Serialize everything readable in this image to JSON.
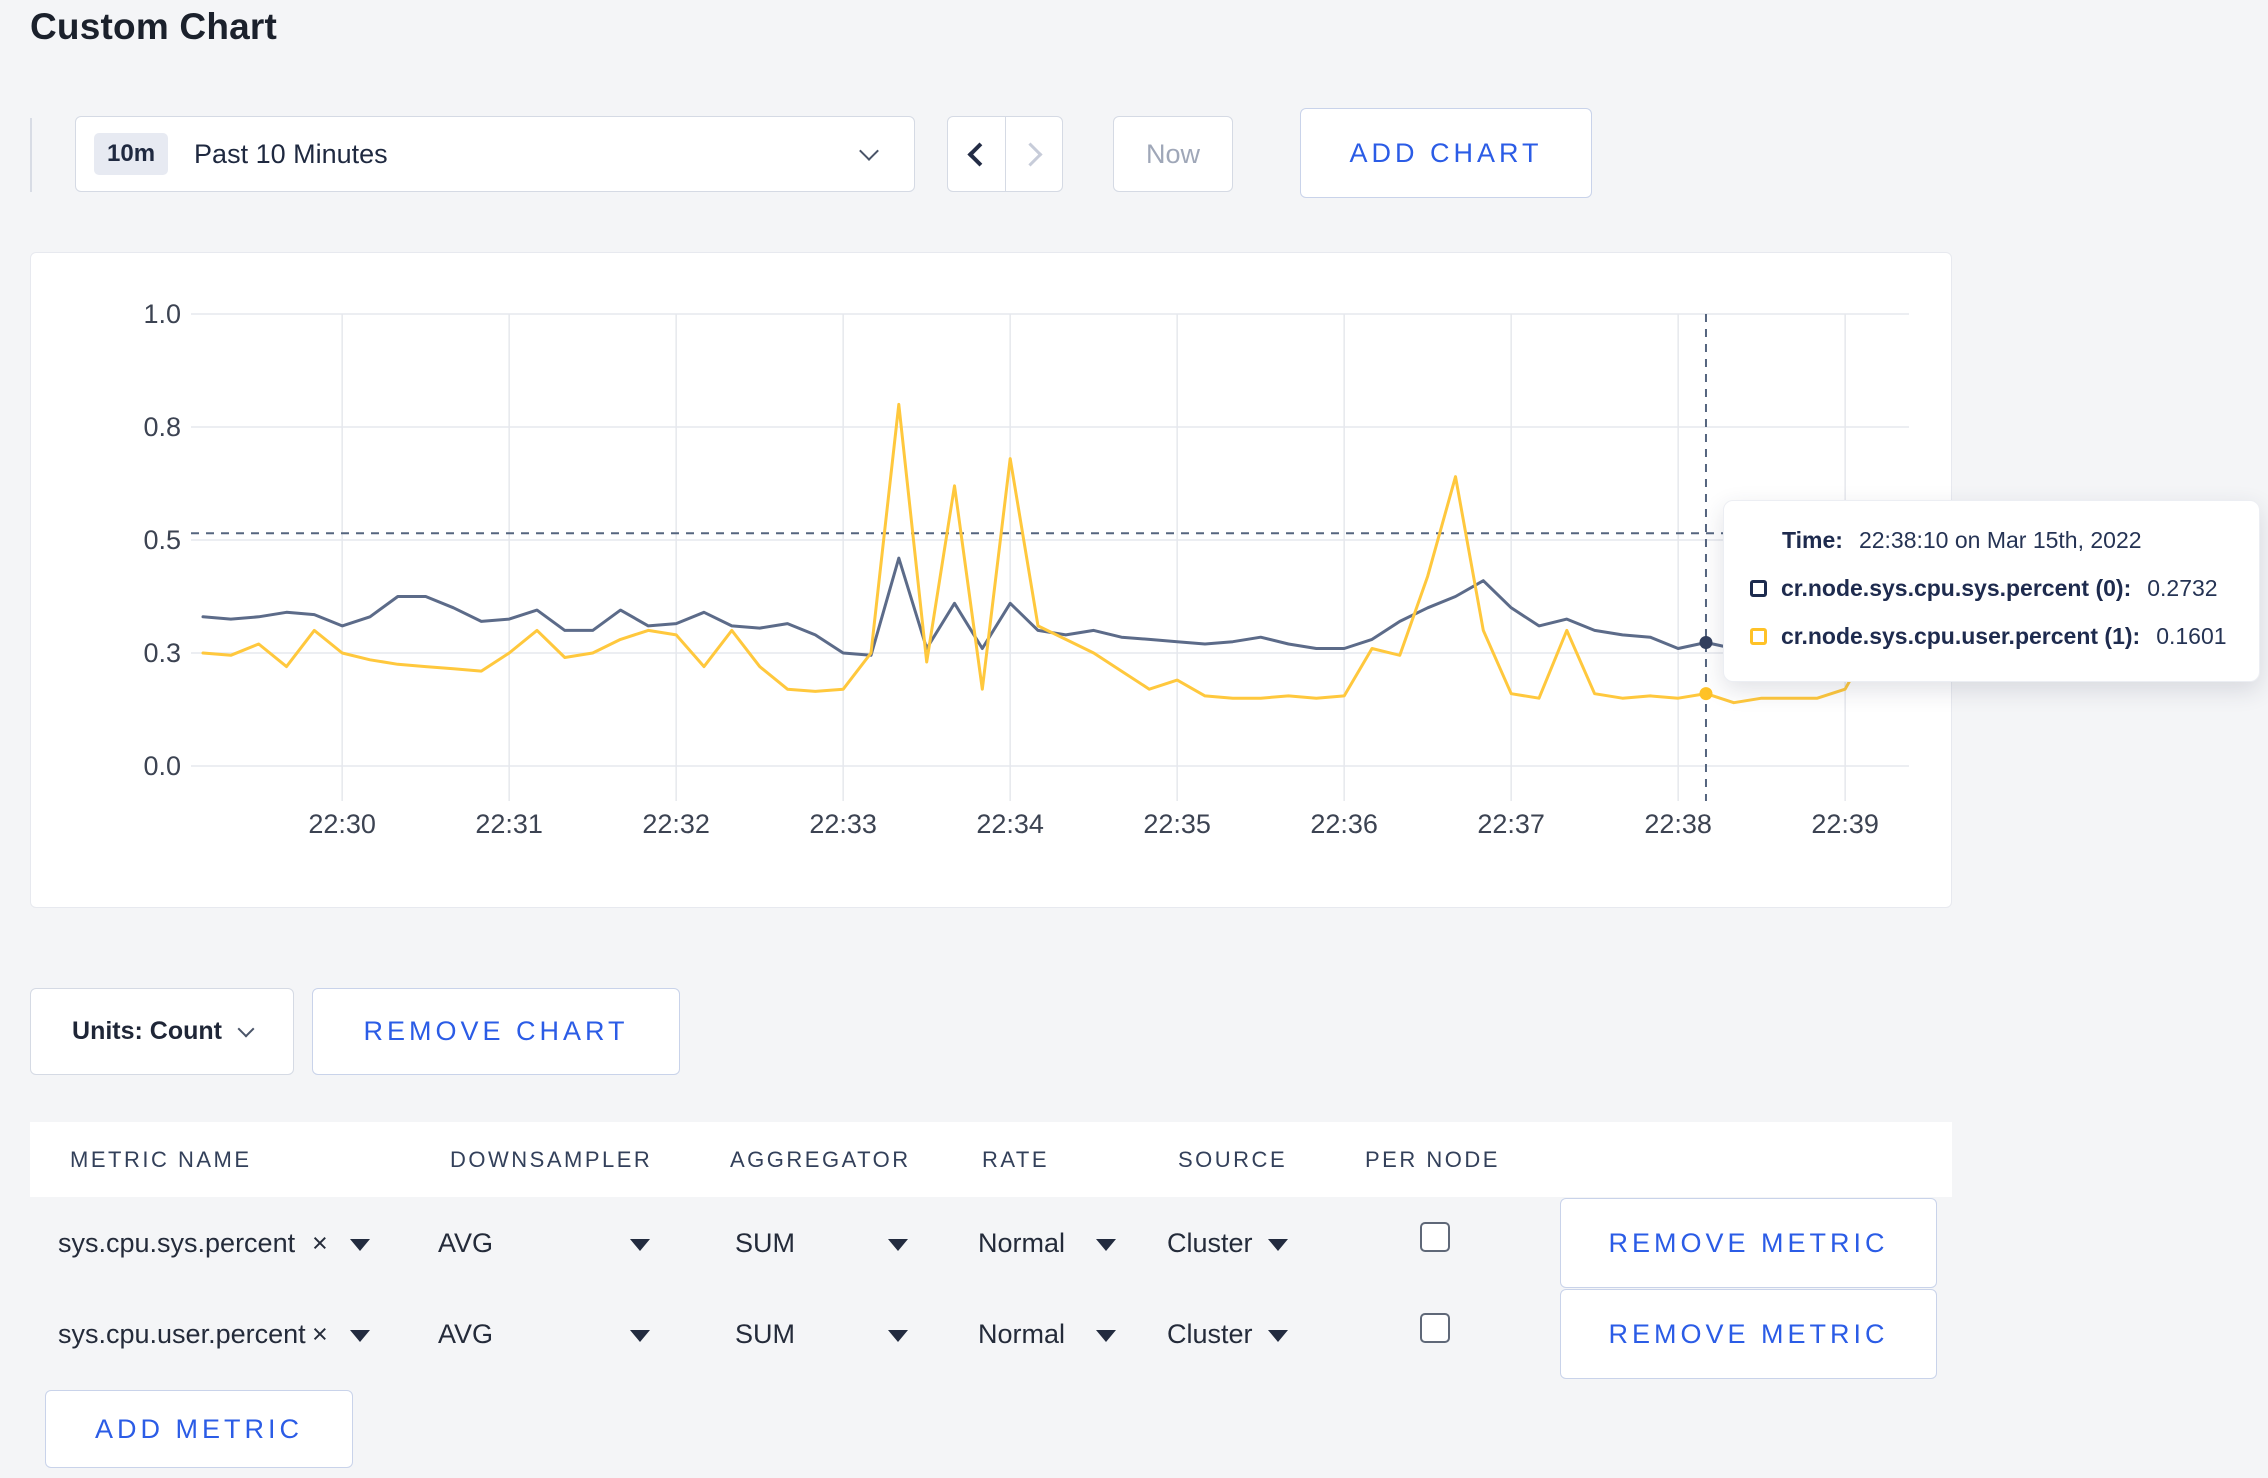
{
  "page": {
    "title": "Custom Chart"
  },
  "toolbar": {
    "time_badge": "10m",
    "time_range": "Past 10 Minutes",
    "now_label": "Now",
    "add_chart_label": "ADD CHART"
  },
  "chart": {
    "units_label": "Units: Count",
    "remove_chart_label": "REMOVE CHART"
  },
  "tooltip": {
    "time_label": "Time:",
    "time_value": "22:38:10 on Mar 15th, 2022",
    "series": [
      {
        "name": "cr.node.sys.cpu.sys.percent (0):",
        "value": "0.2732",
        "color": "#1C2B4E"
      },
      {
        "name": "cr.node.sys.cpu.user.percent (1):",
        "value": "0.1601",
        "color": "#FFC227"
      }
    ]
  },
  "chart_data": {
    "type": "line",
    "title": "",
    "xlabel": "",
    "ylabel": "",
    "ylim": [
      0,
      1
    ],
    "grid": true,
    "x_start_time": "22:29:10",
    "x_step_seconds": 10,
    "x_ticks": [
      "22:30",
      "22:31",
      "22:32",
      "22:33",
      "22:34",
      "22:35",
      "22:36",
      "22:37",
      "22:38",
      "22:39"
    ],
    "y_ticks": [
      {
        "label": "0.0",
        "value": 0
      },
      {
        "label": "0.3",
        "value": 0.25
      },
      {
        "label": "0.5",
        "value": 0.5
      },
      {
        "label": "0.8",
        "value": 0.75
      },
      {
        "label": "1.0",
        "value": 1.0
      }
    ],
    "series": [
      {
        "name": "cr.node.sys.cpu.sys.percent (0)",
        "color": "#5C6B89",
        "dot_color": "#33405F",
        "values": [
          0.33,
          0.325,
          0.33,
          0.34,
          0.335,
          0.31,
          0.33,
          0.375,
          0.375,
          0.35,
          0.32,
          0.325,
          0.345,
          0.3,
          0.3,
          0.345,
          0.31,
          0.315,
          0.34,
          0.31,
          0.305,
          0.315,
          0.29,
          0.25,
          0.245,
          0.46,
          0.26,
          0.36,
          0.26,
          0.36,
          0.3,
          0.29,
          0.3,
          0.285,
          0.28,
          0.275,
          0.27,
          0.275,
          0.285,
          0.27,
          0.26,
          0.26,
          0.28,
          0.32,
          0.35,
          0.375,
          0.41,
          0.35,
          0.31,
          0.325,
          0.3,
          0.29,
          0.285,
          0.26,
          0.2732,
          0.26,
          0.28,
          0.305,
          0.29,
          0.285,
          0.3,
          0.305
        ]
      },
      {
        "name": "cr.node.sys.cpu.user.percent (1)",
        "color": "#FFC83D",
        "dot_color": "#FFC227",
        "values": [
          0.25,
          0.245,
          0.27,
          0.22,
          0.3,
          0.25,
          0.235,
          0.225,
          0.22,
          0.215,
          0.21,
          0.25,
          0.3,
          0.24,
          0.25,
          0.28,
          0.3,
          0.29,
          0.22,
          0.3,
          0.22,
          0.17,
          0.165,
          0.17,
          0.25,
          0.8,
          0.23,
          0.62,
          0.17,
          0.68,
          0.31,
          0.28,
          0.25,
          0.21,
          0.17,
          0.19,
          0.155,
          0.15,
          0.15,
          0.155,
          0.15,
          0.155,
          0.26,
          0.245,
          0.42,
          0.64,
          0.3,
          0.16,
          0.15,
          0.3,
          0.16,
          0.15,
          0.155,
          0.15,
          0.1601,
          0.14,
          0.15,
          0.15,
          0.15,
          0.17,
          0.28,
          0.24
        ]
      }
    ],
    "hover": {
      "time": "22:38:10",
      "index": 54,
      "crosshair_y_value": 0.515,
      "values": [
        0.2732,
        0.1601
      ]
    },
    "legend_position": "tooltip"
  },
  "table": {
    "headers": [
      "METRIC NAME",
      "DOWNSAMPLER",
      "AGGREGATOR",
      "RATE",
      "SOURCE",
      "PER NODE"
    ],
    "rows": [
      {
        "metric": "sys.cpu.sys.percent",
        "clear": "×",
        "downsampler": "AVG",
        "aggregator": "SUM",
        "rate": "Normal",
        "source": "Cluster",
        "per_node_checked": false,
        "remove_label": "REMOVE METRIC"
      },
      {
        "metric": "sys.cpu.user.percent",
        "clear": "×",
        "downsampler": "AVG",
        "aggregator": "SUM",
        "rate": "Normal",
        "source": "Cluster",
        "per_node_checked": false,
        "remove_label": "REMOVE METRIC"
      }
    ],
    "add_metric_label": "ADD METRIC"
  }
}
